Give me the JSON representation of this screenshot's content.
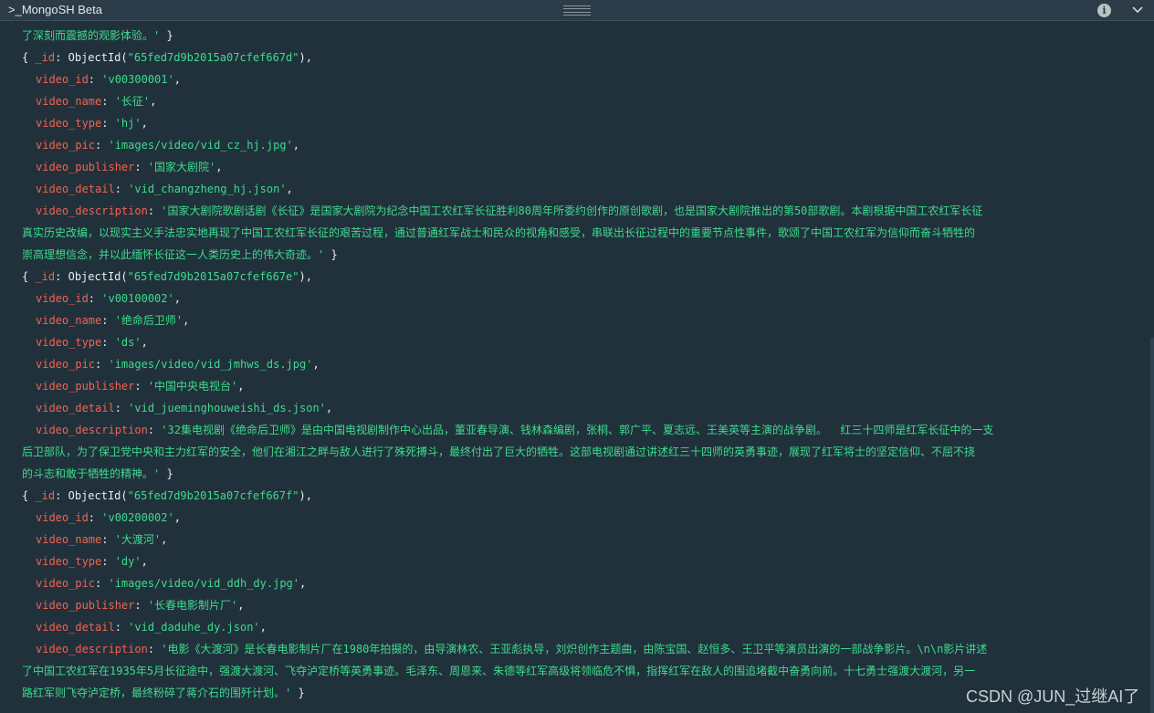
{
  "window": {
    "title": ">_MongoSH Beta"
  },
  "icons": {
    "info": "info-icon",
    "collapse": "chevron-down-icon",
    "drag": "drag-handle-icon"
  },
  "colors": {
    "background": "#21313c",
    "titlebar": "#2b3b47",
    "key": "#f5614e",
    "string": "#3ddb8d",
    "text": "#e8ecec"
  },
  "console": {
    "tail": "了深刻而震撼的观影体验。'",
    "records": [
      {
        "id_value": "65fed7d9b2015a07cfef667d",
        "fields": [
          {
            "key": "video_id",
            "value": "'v00300001'"
          },
          {
            "key": "video_name",
            "value": "'长征'"
          },
          {
            "key": "video_type",
            "value": "'hj'"
          },
          {
            "key": "video_pic",
            "value": "'images/video/vid_cz_hj.jpg'"
          },
          {
            "key": "video_publisher",
            "value": "'国家大剧院'"
          },
          {
            "key": "video_detail",
            "value": "'vid_changzheng_hj.json'"
          }
        ],
        "desc_key": "video_description",
        "desc_lines": [
          "'国家大剧院歌剧话剧《长征》是国家大剧院为纪念中国工农红军长征胜利80周年所委约创作的原创歌剧，也是国家大剧院推出的第50部歌剧。本剧根据中国工农红军长征",
          "真实历史改编，以现实主义手法忠实地再现了中国工农红军长征的艰苦过程，通过普通红军战士和民众的视角和感受，串联出长征过程中的重要节点性事件，歌颂了中国工农红军为信仰而奋斗牺牲的",
          "崇高理想信念，并以此缅怀长征这一人类历史上的伟大奇迹。'"
        ]
      },
      {
        "id_value": "65fed7d9b2015a07cfef667e",
        "fields": [
          {
            "key": "video_id",
            "value": "'v00100002'"
          },
          {
            "key": "video_name",
            "value": "'绝命后卫师'"
          },
          {
            "key": "video_type",
            "value": "'ds'"
          },
          {
            "key": "video_pic",
            "value": "'images/video/vid_jmhws_ds.jpg'"
          },
          {
            "key": "video_publisher",
            "value": "'中国中央电视台'"
          },
          {
            "key": "video_detail",
            "value": "'vid_jueminghouweishi_ds.json'"
          }
        ],
        "desc_key": "video_description",
        "desc_lines": [
          "'32集电视剧《绝命后卫师》是由中国电视剧制作中心出品，董亚春导演、钱林森编剧，张桐、郭广平、夏志远、王美英等主演的战争剧。  红三十四师是红军长征中的一支",
          "后卫部队，为了保卫党中央和主力红军的安全，他们在湘江之畔与敌人进行了殊死搏斗，最终付出了巨大的牺牲。这部电视剧通过讲述红三十四师的英勇事迹，展现了红军将士的坚定信仰、不屈不挠",
          "的斗志和敢于牺牲的精神。'"
        ]
      },
      {
        "id_value": "65fed7d9b2015a07cfef667f",
        "fields": [
          {
            "key": "video_id",
            "value": "'v00200002'"
          },
          {
            "key": "video_name",
            "value": "'大渡河'"
          },
          {
            "key": "video_type",
            "value": "'dy'"
          },
          {
            "key": "video_pic",
            "value": "'images/video/vid_ddh_dy.jpg'"
          },
          {
            "key": "video_publisher",
            "value": "'长春电影制片厂'"
          },
          {
            "key": "video_detail",
            "value": "'vid_daduhe_dy.json'"
          }
        ],
        "desc_key": "video_description",
        "desc_lines": [
          "'电影《大渡河》是长春电影制片厂在1980年拍摄的，由导演林农、王亚彪执导，刘炽创作主题曲，由陈宝国、赵恒多、王卫平等演员出演的一部战争影片。\\n\\n影片讲述",
          "了中国工农红军在1935年5月长征途中，强渡大渡河、飞夺泸定桥等英勇事迹。毛泽东、周恩来、朱德等红军高级将领临危不惧，指挥红军在敌人的围追堵截中奋勇向前。十七勇士强渡大渡河，另一",
          "路红军则飞夺泸定桥，最终粉碎了蒋介石的围歼计划。'"
        ]
      }
    ]
  },
  "watermark": "CSDN @JUN_过继AI了"
}
